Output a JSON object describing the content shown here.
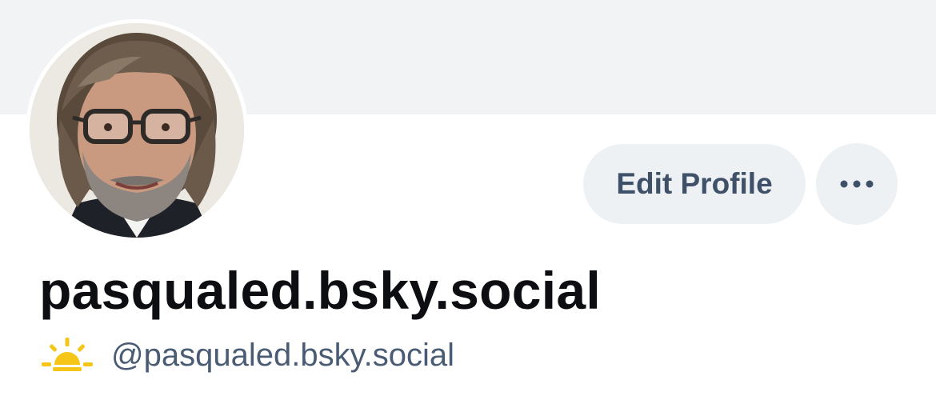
{
  "profile": {
    "display_name": "pasqualed.bsky.social",
    "handle": "@pasqualed.bsky.social",
    "handle_icon": "sunrise-icon",
    "avatar_icon": "avatar-photo"
  },
  "actions": {
    "edit_profile_label": "Edit Profile",
    "more_icon": "ellipsis-icon"
  },
  "colors": {
    "banner": "#f1f3f5",
    "button_bg": "#eef1f4",
    "button_text": "#3f5168",
    "name_text": "#0c0e12",
    "handle_text": "#4a5c73",
    "sun": "#f5c518"
  }
}
